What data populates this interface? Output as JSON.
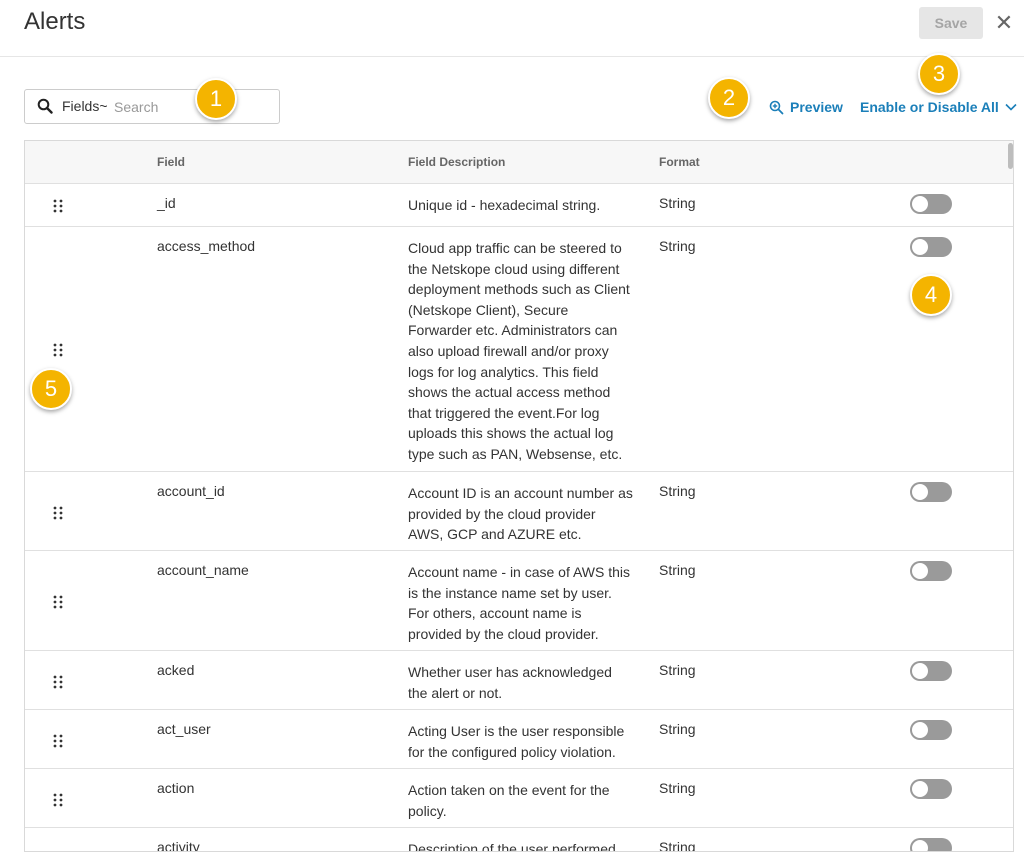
{
  "header": {
    "title": "Alerts",
    "save_label": "Save",
    "close_glyph": "✕"
  },
  "search": {
    "prefix_label": "Fields~",
    "placeholder": "Search",
    "value": ""
  },
  "actions": {
    "preview_label": "Preview",
    "enable_disable_label": "Enable or Disable All"
  },
  "callouts": [
    "1",
    "2",
    "3",
    "4",
    "5"
  ],
  "table": {
    "columns": {
      "field": "Field",
      "description": "Field Description",
      "format": "Format"
    },
    "rows": [
      {
        "field": "_id",
        "description": "Unique id - hexadecimal string.",
        "format": "String",
        "enabled": false
      },
      {
        "field": "access_method",
        "description": "Cloud app traffic can be steered to the Netskope cloud using different deployment methods such as Client (Netskope Client), Secure Forwarder etc. Administrators can also upload firewall and/or proxy logs for log analytics. This field shows the actual access method that triggered the event.For log uploads this shows the actual log type such as PAN, Websense, etc.",
        "format": "String",
        "enabled": false
      },
      {
        "field": "account_id",
        "description": "Account ID is an account number as provided by the cloud provider AWS, GCP and AZURE etc.",
        "format": "String",
        "enabled": false
      },
      {
        "field": "account_name",
        "description": "Account name - in case of AWS this is the instance name set by user. For others, account name is provided by the cloud provider.",
        "format": "String",
        "enabled": false
      },
      {
        "field": "acked",
        "description": "Whether user has acknowledged the alert or not.",
        "format": "String",
        "enabled": false
      },
      {
        "field": "act_user",
        "description": "Acting User is the user responsible for the configured policy violation.",
        "format": "String",
        "enabled": false
      },
      {
        "field": "action",
        "description": "Action taken on the event for the policy.",
        "format": "String",
        "enabled": false
      },
      {
        "field": "activity",
        "description": "Description of the user performed",
        "format": "String",
        "enabled": false
      }
    ]
  },
  "colors": {
    "accent": "#1b7fb9",
    "badge": "#f4b400",
    "toggle_off": "#9a9a9a",
    "save_disabled_bg": "#e6e6e6"
  },
  "icons": {
    "search": "search-icon",
    "preview": "zoom-in-icon",
    "dropdown": "chevron-down-icon",
    "drag": "drag-handle-icon",
    "close": "close-icon"
  }
}
